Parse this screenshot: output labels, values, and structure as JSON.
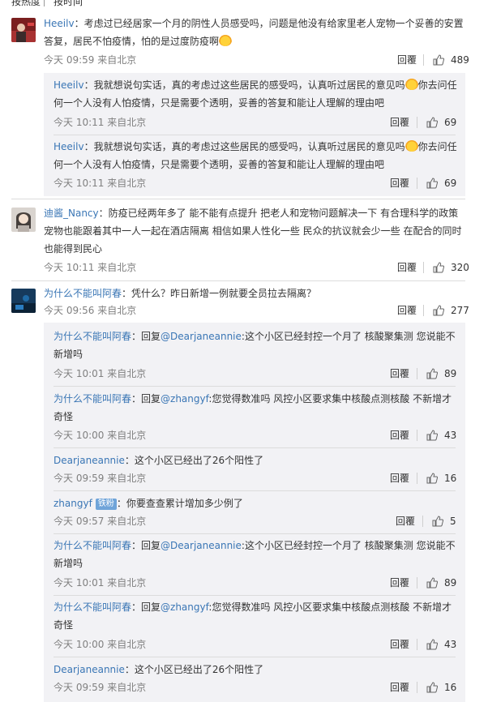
{
  "sort": {
    "hot": "按热度",
    "time": "按时间"
  },
  "icons": {
    "like": "thumbs-up-icon",
    "emoji": "laughing-tears-emoji"
  },
  "colors": {
    "link": "#3a76b5",
    "meta": "#808080",
    "sub_bg": "#f2f2f5"
  },
  "comments": [
    {
      "user": "Heeilv",
      "text_l1": "：考虑过已经居家一个月的阴性人员感受吗，问题是他没有给家里老人宠物一个妥善的安置",
      "text_l2": "答复，居民不怕疫情，怕的是过度防疫啊",
      "time": "今天 09:59 来自北京",
      "reply": "回覆",
      "likes": "489",
      "replies": [
        {
          "user": "Heeilv",
          "text_l1": "：我就想说句实话，真的考虑过这些居民的感受吗，认真听过居民的意见吗",
          "text_l1b": "你去问任",
          "text_l2": "何一个人没有人怕疫情，只是需要个透明，妥善的答复和能让人理解的理由吧",
          "time": "今天 10:11 来自北京",
          "reply": "回覆",
          "likes": "69"
        },
        {
          "user": "Heeilv",
          "text_l1": "：我就想说句实话，真的考虑过这些居民的感受吗，认真听过居民的意见吗",
          "text_l1b": "你去问任",
          "text_l2": "何一个人没有人怕疫情，只是需要个透明，妥善的答复和能让人理解的理由吧",
          "time": "今天 10:11 来自北京",
          "reply": "回覆",
          "likes": "69"
        }
      ]
    },
    {
      "user": "迪酱_Nancy",
      "text_l1": "：防疫已经两年多了 能不能有点提升 把老人和宠物问题解决一下 有合理科学的政策",
      "text_l2": "宠物也能跟着其中一人一起在酒店隔离 相信如果人性化一些 民众的抗议就会少一些 在配合的同时",
      "text_l3": "也能得到民心",
      "time": "今天 10:11 来自北京",
      "reply": "回覆",
      "likes": "320"
    },
    {
      "user": "为什么不能叫阿春",
      "text_l1": "：凭什么？昨日新增一例就要全员拉去隔离？",
      "time": "今天 09:56 来自北京",
      "reply": "回覆",
      "likes": "277",
      "replies": [
        {
          "user": "为什么不能叫阿春",
          "prefix": "：回复",
          "mention": "@Dearjaneannie",
          "text_l1": ":这个小区已经封控一个月了 核酸聚集测 您说能不",
          "text_l2": "新增吗",
          "time": "今天 10:01 来自北京",
          "reply": "回覆",
          "likes": "89"
        },
        {
          "user": "为什么不能叫阿春",
          "prefix": "：回复",
          "mention": "@zhangyf",
          "text_l1": ":您觉得数准吗 风控小区要求集中核酸点测核酸 不新增才",
          "text_l2": "奇怪",
          "time": "今天 10:00 来自北京",
          "reply": "回覆",
          "likes": "43"
        },
        {
          "user": "Dearjaneannie",
          "text_l1": "：这个小区已经出了26个阳性了",
          "time": "今天 09:59 来自北京",
          "reply": "回覆",
          "likes": "16"
        },
        {
          "user": "zhangyf",
          "badge": "铁粉",
          "text_l1": "：你要查查累计增加多少例了",
          "time": "今天 09:57 来自北京",
          "reply": "回覆",
          "likes": "5"
        },
        {
          "user": "为什么不能叫阿春",
          "prefix": "：回复",
          "mention": "@Dearjaneannie",
          "text_l1": ":这个小区已经封控一个月了 核酸聚集测 您说能不",
          "text_l2": "新增吗",
          "time": "今天 10:01 来自北京",
          "reply": "回覆",
          "likes": "89"
        },
        {
          "user": "为什么不能叫阿春",
          "prefix": "：回复",
          "mention": "@zhangyf",
          "text_l1": ":您觉得数准吗 风控小区要求集中核酸点测核酸 不新增才",
          "text_l2": "奇怪",
          "time": "今天 10:00 来自北京",
          "reply": "回覆",
          "likes": "43"
        },
        {
          "user": "Dearjaneannie",
          "text_l1": "：这个小区已经出了26个阳性了",
          "time": "今天 09:59 来自北京",
          "reply": "回覆",
          "likes": "16"
        }
      ]
    }
  ]
}
